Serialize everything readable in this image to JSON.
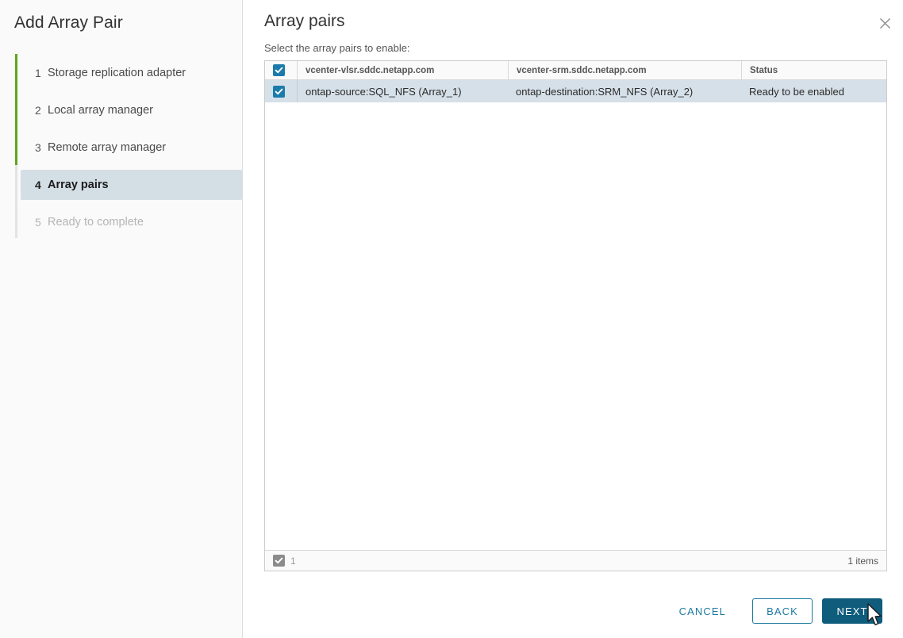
{
  "wizard": {
    "title": "Add Array Pair",
    "steps": [
      {
        "num": "1",
        "label": "Storage replication adapter",
        "state": "done"
      },
      {
        "num": "2",
        "label": "Local array manager",
        "state": "done"
      },
      {
        "num": "3",
        "label": "Remote array manager",
        "state": "done"
      },
      {
        "num": "4",
        "label": "Array pairs",
        "state": "active"
      },
      {
        "num": "5",
        "label": "Ready to complete",
        "state": "disabled"
      }
    ],
    "progress_color": "#62a420",
    "active_highlight_color": "#d4dee5"
  },
  "page": {
    "title": "Array pairs",
    "subtitle": "Select the array pairs to enable:",
    "close_icon": "close-icon"
  },
  "grid": {
    "header_checkbox": {
      "icon": "check-icon",
      "checked": true,
      "color": "#1b7bab"
    },
    "columns": [
      {
        "key": "a",
        "label": "vcenter-vlsr.sddc.netapp.com"
      },
      {
        "key": "b",
        "label": "vcenter-srm.sddc.netapp.com"
      },
      {
        "key": "c",
        "label": "Status"
      }
    ],
    "rows": [
      {
        "checked": true,
        "a": "ontap-source:SQL_NFS (Array_1)",
        "b": "ontap-destination:SRM_NFS (Array_2)",
        "c": "Ready to be enabled"
      }
    ],
    "footer": {
      "checkbox_icon": "check-icon",
      "selected_count": "1",
      "items_label": "1 items"
    }
  },
  "buttons": {
    "cancel": "CANCEL",
    "back": "BACK",
    "next": "NEXT",
    "next_bg": "#0f5c7d",
    "link_color": "#1b7a9e"
  }
}
